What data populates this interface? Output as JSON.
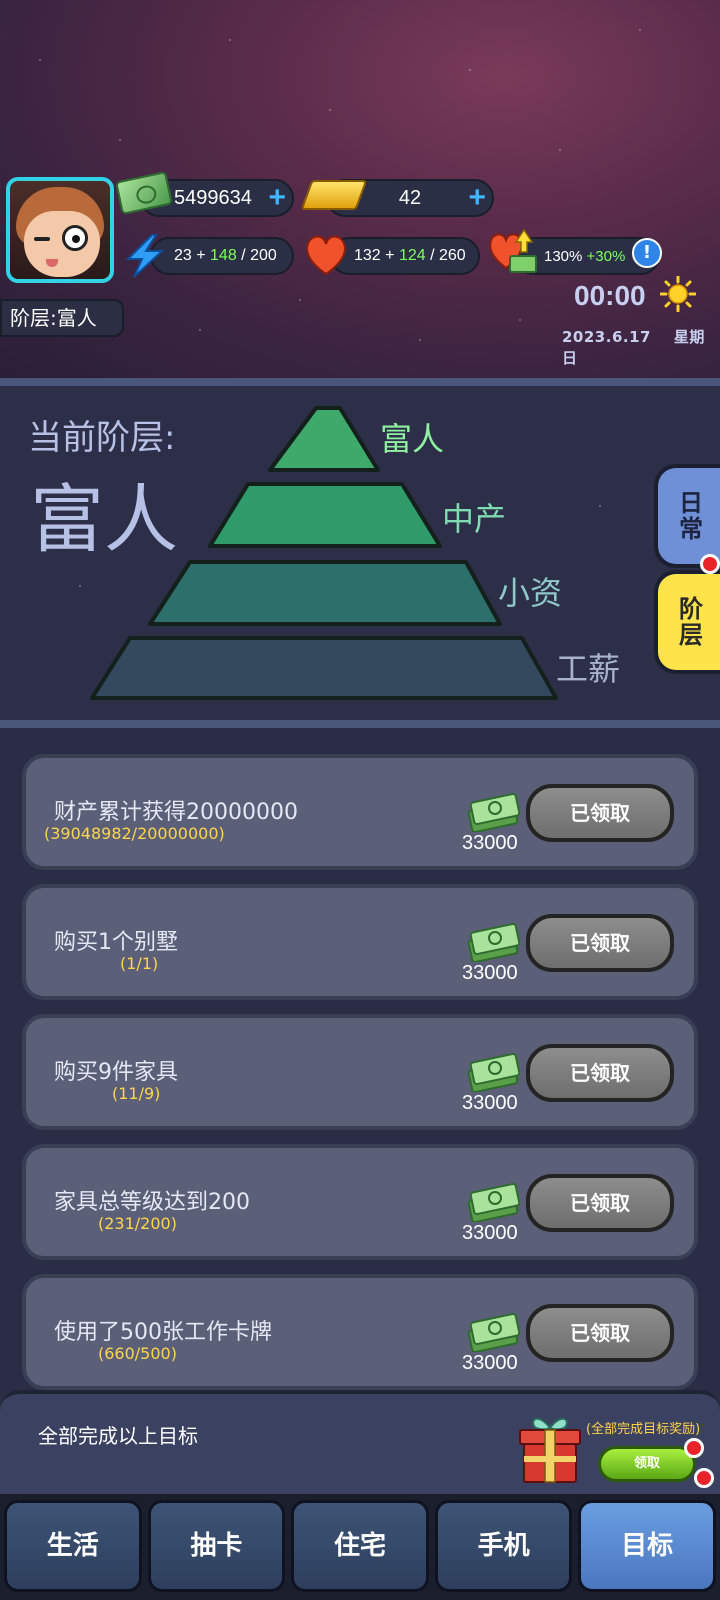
{
  "header": {
    "cash": "5499634",
    "gold": "42",
    "energy": {
      "current": "23",
      "bonus": "148",
      "max": "200"
    },
    "health": {
      "current": "132",
      "bonus": "124",
      "max": "260"
    },
    "income_boost": {
      "base": "130%",
      "bonus": "+30%"
    },
    "tier_badge": "阶层:富人",
    "clock": "00:00",
    "date": "2023.6.17",
    "weekday": "星期日"
  },
  "pyramid": {
    "current_label": "当前阶层:",
    "current_tier": "富人",
    "levels": [
      "富人",
      "中产",
      "小资",
      "工薪"
    ]
  },
  "side_tabs": {
    "daily": "日常",
    "tier": "阶层"
  },
  "quests": [
    {
      "title": "财产累计获得20000000",
      "progress": "(39048982/20000000)",
      "reward": "33000",
      "button": "已领取"
    },
    {
      "title": "购买1个别墅",
      "progress": "(1/1)",
      "reward": "33000",
      "button": "已领取"
    },
    {
      "title": "购买9件家具",
      "progress": "(11/9)",
      "reward": "33000",
      "button": "已领取"
    },
    {
      "title": "家具总等级达到200",
      "progress": "(231/200)",
      "reward": "33000",
      "button": "已领取"
    },
    {
      "title": "使用了500张工作卡牌",
      "progress": "(660/500)",
      "reward": "33000",
      "button": "已领取"
    }
  ],
  "goal": {
    "text": "全部完成以上目标",
    "reward_label": "(全部完成目标奖励)",
    "claim_button": "领取"
  },
  "nav": [
    "生活",
    "抽卡",
    "住宅",
    "手机",
    "目标"
  ],
  "icons": {
    "cash": "cash-icon",
    "gold": "gold-bar-icon",
    "energy": "lightning-icon",
    "health": "heart-icon",
    "boost": "heart-cash-up-icon",
    "info": "info-icon",
    "weather": "sun-icon",
    "gift": "gift-icon"
  },
  "colors": {
    "accent_cyan": "#32d3e6",
    "bonus_green": "#7dff5a",
    "progress_yellow": "#ffd54a",
    "notify_red": "#e8232a",
    "pyramid": [
      "#3fa96b",
      "#2f9a6a",
      "#2d6f6a",
      "#34495e"
    ]
  }
}
